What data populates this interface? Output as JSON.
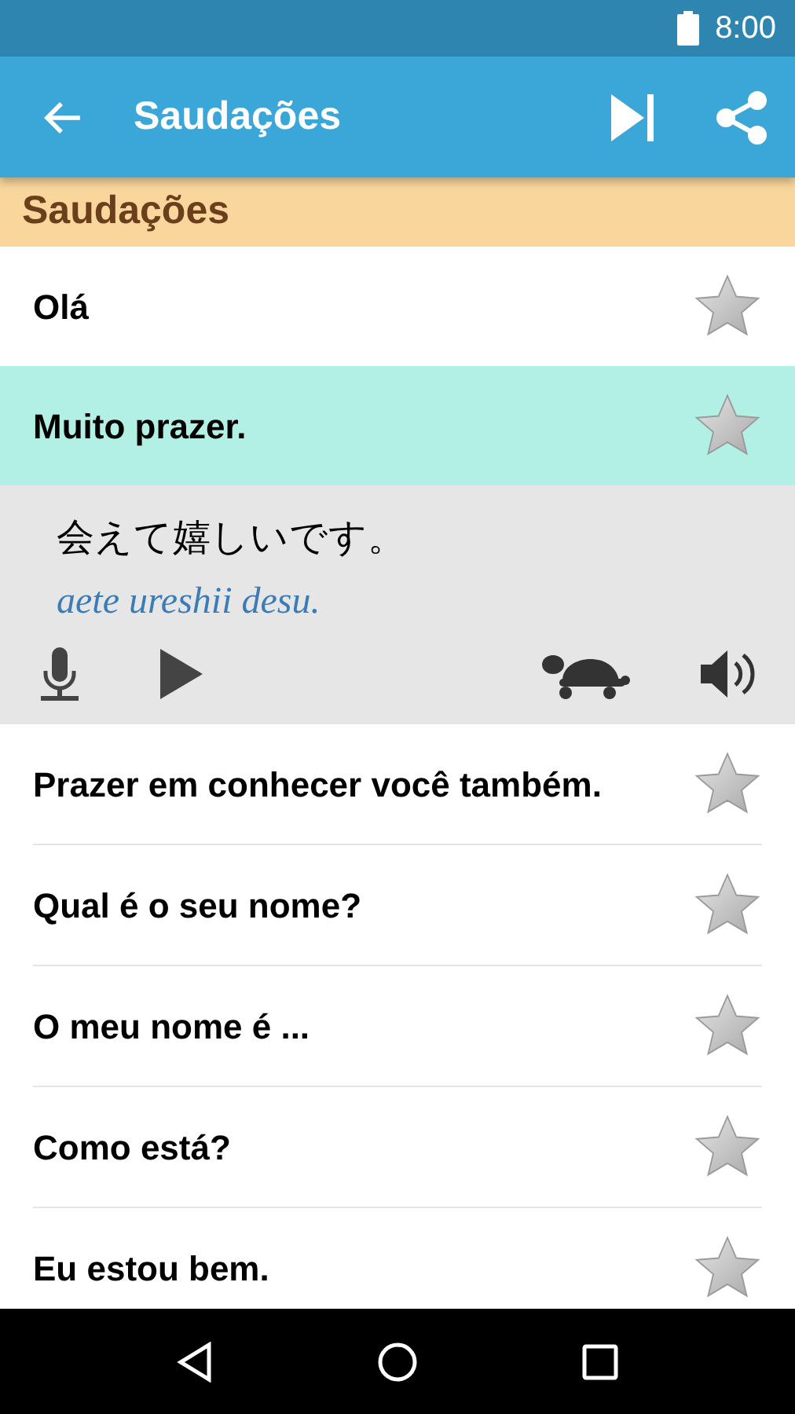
{
  "status_bar": {
    "time": "8:00"
  },
  "app_bar": {
    "title": "Saudações"
  },
  "section": {
    "title": "Saudações"
  },
  "phrases": [
    {
      "text": "Olá",
      "selected": false,
      "starred": false,
      "expanded": false
    },
    {
      "text": "Muito prazer.",
      "selected": true,
      "starred": false,
      "expanded": true,
      "translation": "会えて嬉しいです。",
      "romanization": "aete ureshii desu."
    },
    {
      "text": "Prazer em conhecer você também.",
      "selected": false,
      "starred": false,
      "expanded": false
    },
    {
      "text": "Qual é o seu nome?",
      "selected": false,
      "starred": false,
      "expanded": false
    },
    {
      "text": "O meu nome é ...",
      "selected": false,
      "starred": false,
      "expanded": false
    },
    {
      "text": "Como está?",
      "selected": false,
      "starred": false,
      "expanded": false
    },
    {
      "text": "Eu estou bem.",
      "selected": false,
      "starred": false,
      "expanded": false
    }
  ]
}
